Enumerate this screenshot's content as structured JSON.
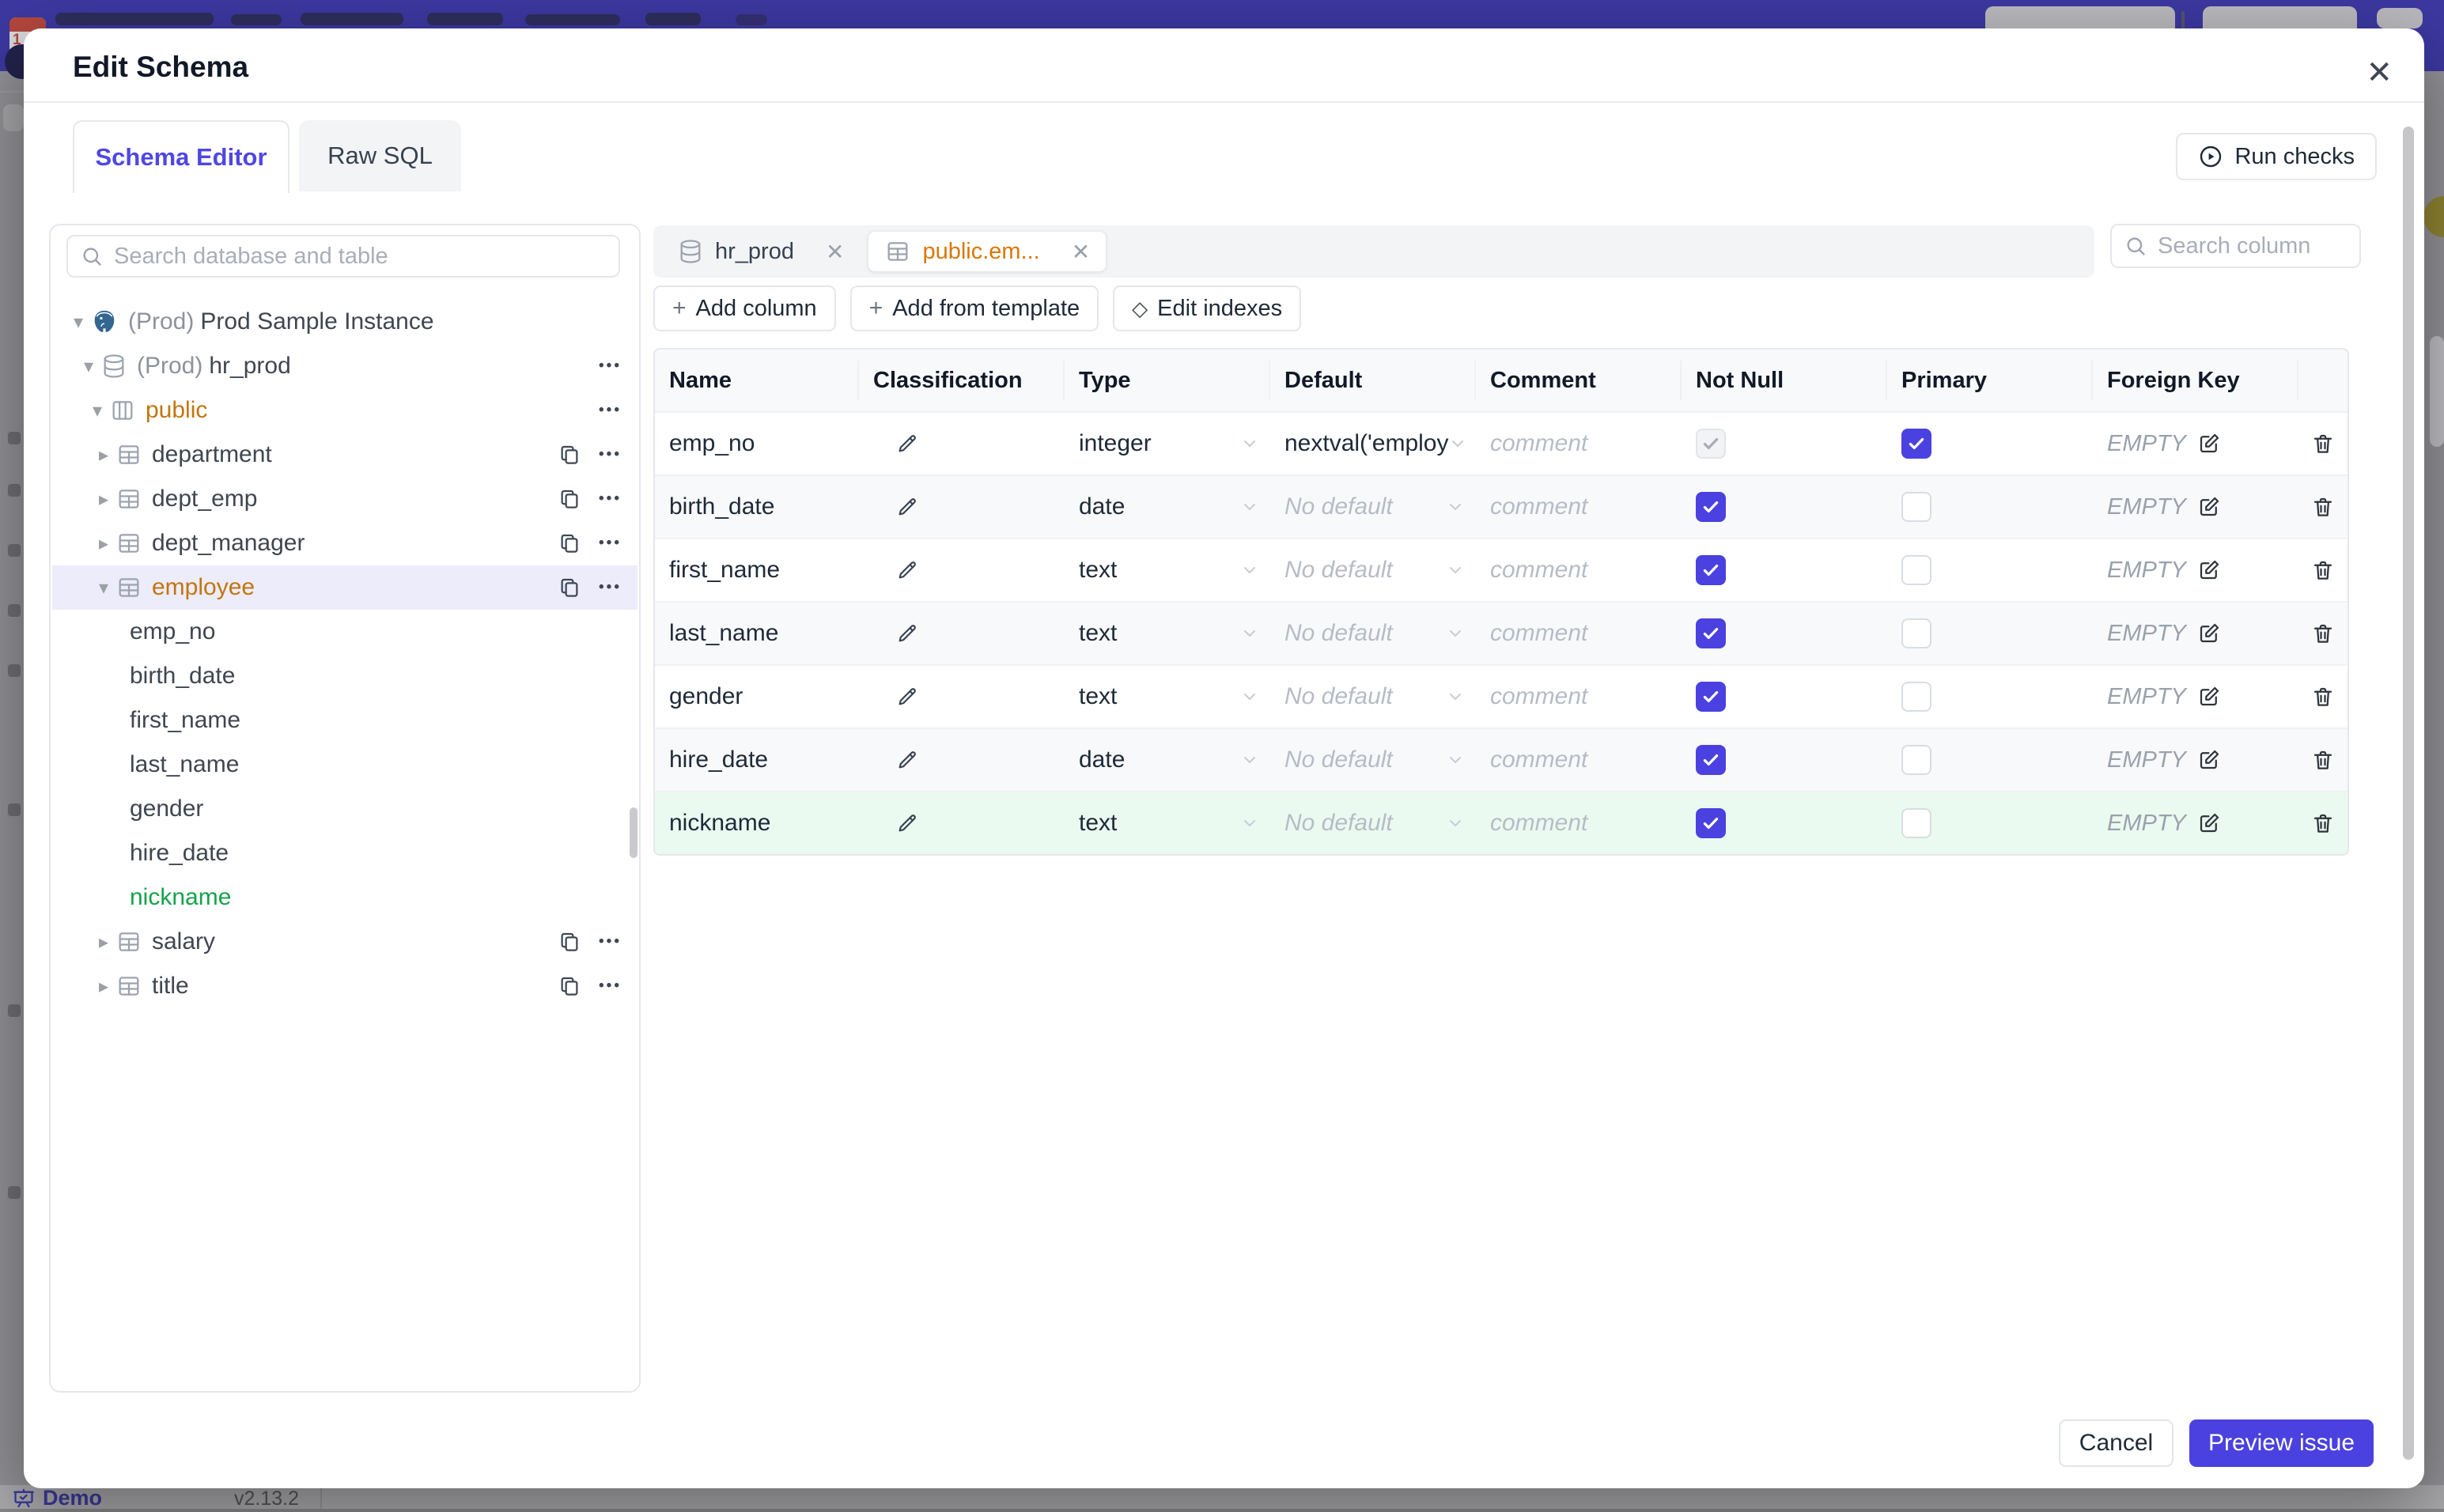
{
  "colors": {
    "accent": "#4f46e5",
    "brand_bar": "#3c38a0",
    "amber": "#d97706",
    "green": "#16a34a",
    "selected_row": "#edecfb",
    "green_row": "#eafaf0",
    "checkbox_checked": "#4a41e0"
  },
  "modal": {
    "title": "Edit Schema",
    "close_icon": "x",
    "tabs": [
      "Schema Editor",
      "Raw SQL"
    ],
    "run_checks": "Run checks"
  },
  "sidebar": {
    "search_placeholder": "Search database and table",
    "tree": [
      {
        "level": 0,
        "caret": "down",
        "icon": "postgres",
        "prefix": "(Prod)",
        "label": "Prod Sample Instance"
      },
      {
        "level": 1,
        "caret": "down",
        "icon": "database",
        "prefix": "(Prod)",
        "label": "hr_prod",
        "menu": true
      },
      {
        "level": 2,
        "caret": "down",
        "icon": "schema",
        "label": "public",
        "color": "amber",
        "menu": true
      },
      {
        "level": 3,
        "caret": "right",
        "icon": "table",
        "label": "department",
        "copy": true,
        "menu": true
      },
      {
        "level": 3,
        "caret": "right",
        "icon": "table",
        "label": "dept_emp",
        "copy": true,
        "menu": true
      },
      {
        "level": 3,
        "caret": "right",
        "icon": "table",
        "label": "dept_manager",
        "copy": true,
        "menu": true
      },
      {
        "level": 3,
        "caret": "down",
        "icon": "table",
        "label": "employee",
        "color": "amber",
        "selected": true,
        "copy": true,
        "menu": true
      },
      {
        "level": 4,
        "label": "emp_no"
      },
      {
        "level": 4,
        "label": "birth_date"
      },
      {
        "level": 4,
        "label": "first_name"
      },
      {
        "level": 4,
        "label": "last_name"
      },
      {
        "level": 4,
        "label": "gender"
      },
      {
        "level": 4,
        "label": "hire_date"
      },
      {
        "level": 4,
        "label": "nickname",
        "color": "green"
      },
      {
        "level": 3,
        "caret": "right",
        "icon": "table",
        "label": "salary",
        "copy": true,
        "menu": true
      },
      {
        "level": 3,
        "caret": "right",
        "icon": "table",
        "label": "title",
        "copy": true,
        "menu": true
      }
    ]
  },
  "main": {
    "chips": [
      {
        "icon": "database",
        "label": "hr_prod",
        "close": "x",
        "active": false
      },
      {
        "icon": "table",
        "label": "public.em...",
        "close": "x",
        "active": true
      }
    ],
    "search_placeholder": "Search column",
    "toolbar": [
      {
        "symbol": "+",
        "label": "Add column"
      },
      {
        "symbol": "+",
        "label": "Add from template"
      },
      {
        "symbol": "◇",
        "label": "Edit indexes"
      }
    ],
    "table": {
      "headers": [
        "Name",
        "Classification",
        "Type",
        "Default",
        "Comment",
        "Not Null",
        "Primary",
        "Foreign Key",
        ""
      ],
      "comment_placeholder": "comment",
      "no_default_placeholder": "No default",
      "foreign_key_empty": "EMPTY",
      "rows": [
        {
          "name": "emp_no",
          "type": "integer",
          "default": "nextval('employ",
          "default_is_placeholder": false,
          "not_null": {
            "checked": true,
            "disabled": true
          },
          "primary": {
            "checked": true
          },
          "highlight": null
        },
        {
          "name": "birth_date",
          "type": "date",
          "default": "No default",
          "default_is_placeholder": true,
          "not_null": {
            "checked": true,
            "disabled": false
          },
          "primary": {
            "checked": false
          },
          "highlight": null
        },
        {
          "name": "first_name",
          "type": "text",
          "default": "No default",
          "default_is_placeholder": true,
          "not_null": {
            "checked": true,
            "disabled": false
          },
          "primary": {
            "checked": false
          },
          "highlight": null
        },
        {
          "name": "last_name",
          "type": "text",
          "default": "No default",
          "default_is_placeholder": true,
          "not_null": {
            "checked": true,
            "disabled": false
          },
          "primary": {
            "checked": false
          },
          "highlight": null
        },
        {
          "name": "gender",
          "type": "text",
          "default": "No default",
          "default_is_placeholder": true,
          "not_null": {
            "checked": true,
            "disabled": false
          },
          "primary": {
            "checked": false
          },
          "highlight": null
        },
        {
          "name": "hire_date",
          "type": "date",
          "default": "No default",
          "default_is_placeholder": true,
          "not_null": {
            "checked": true,
            "disabled": false
          },
          "primary": {
            "checked": false
          },
          "highlight": null
        },
        {
          "name": "nickname",
          "type": "text",
          "default": "No default",
          "default_is_placeholder": true,
          "not_null": {
            "checked": true,
            "disabled": false
          },
          "primary": {
            "checked": false
          },
          "highlight": "green"
        }
      ]
    }
  },
  "footer": {
    "cancel": "Cancel",
    "preview_issue": "Preview issue"
  },
  "statusbar": {
    "demo": "Demo",
    "version": "v2.13.2"
  },
  "icons": [
    "search-icon",
    "postgres-icon",
    "database-icon",
    "schema-icon",
    "table-icon",
    "copy-icon",
    "ellipsis-icon",
    "caret-icon",
    "pencil-icon",
    "chevron-down-icon",
    "checkbox-check-icon",
    "edit-square-icon",
    "trash-icon",
    "play-circle-icon",
    "plus-icon",
    "diamond-icon",
    "close-icon",
    "presentation-icon"
  ]
}
